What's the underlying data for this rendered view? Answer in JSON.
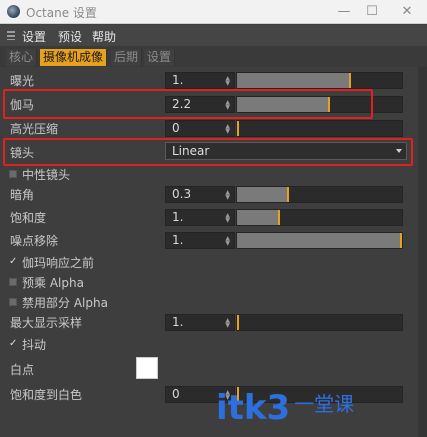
{
  "window": {
    "title": "Octane 设置",
    "minimize_glyph": "—",
    "maximize_glyph": "☐",
    "close_glyph": "✕"
  },
  "menu": [
    "设置",
    "预设",
    "帮助"
  ],
  "tabs": [
    {
      "label": "核心",
      "active": false
    },
    {
      "label": "摄像机成像",
      "active": true
    },
    {
      "label": "后期",
      "active": false
    },
    {
      "label": "设置",
      "active": false
    }
  ],
  "params": {
    "exposure": {
      "label": "曝光",
      "value": "1.",
      "slider_fraction": 0.68
    },
    "gamma": {
      "label": "伽马",
      "value": "2.2",
      "slider_fraction": 0.55
    },
    "highlight_compression": {
      "label": "高光压缩",
      "value": "0",
      "slider_fraction": 0.0
    },
    "lens": {
      "label": "镜头",
      "selected": "Linear"
    },
    "neutral_lens": {
      "label": "中性镜头",
      "checked": false
    },
    "vignetting": {
      "label": "暗角",
      "value": "0.3",
      "slider_fraction": 0.3
    },
    "saturation": {
      "label": "饱和度",
      "value": "1.",
      "slider_fraction": 0.25
    },
    "denoise": {
      "label": "噪点移除",
      "value": "1.",
      "slider_fraction": 1.0
    },
    "gamma_response": {
      "label": "伽玛响应之前",
      "checked": true
    },
    "premultiplied_alpha": {
      "label": "预乘 Alpha",
      "checked": false
    },
    "disable_partial_alpha": {
      "label": "禁用部分 Alpha",
      "checked": false
    },
    "max_display_samples": {
      "label": "最大显示采样",
      "value": "1.",
      "slider_fraction": 0.0
    },
    "dithering": {
      "label": "抖动",
      "checked": true
    },
    "white_point": {
      "label": "白点",
      "color": "#ffffff"
    },
    "saturation_to_white": {
      "label": "饱和度到白色",
      "value": "0",
      "slider_fraction": 0.0
    }
  },
  "colors": {
    "accent": "#e8a11d",
    "highlight": "#e0211d"
  },
  "watermark": {
    "main": "itk3",
    "sub": "一堂课"
  }
}
